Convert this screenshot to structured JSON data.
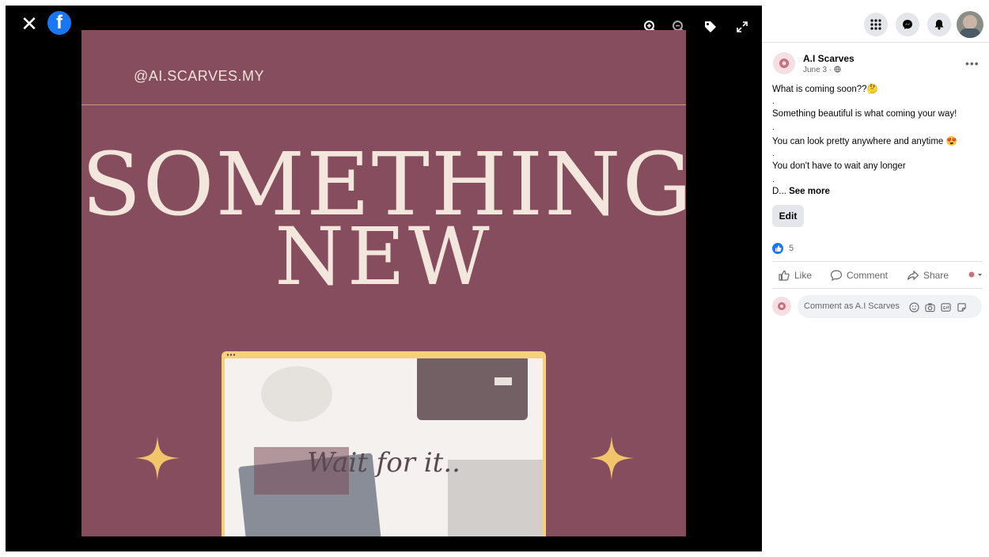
{
  "viewer": {
    "close_glyph": "✕",
    "logo_glyph": "f",
    "controls": [
      "zoom-in-icon",
      "zoom-out-icon",
      "tag-icon",
      "fullscreen-icon"
    ],
    "image": {
      "handle": "@AI.SCARVES.MY",
      "headline_line1": "SOMETHING",
      "headline_line2": "NEW",
      "inset_text": "Wait for it..",
      "background_color": "#864d5e",
      "accent_color": "#f6d17a"
    }
  },
  "sidebar": {
    "nav_icons": [
      "menu-grid-icon",
      "messenger-icon",
      "notifications-icon",
      "profile-avatar"
    ],
    "post": {
      "page_name": "A.I Scarves",
      "date": "June 3 ·",
      "more_glyph": "•••",
      "lines": [
        "What is coming soon??🤔",
        ".",
        "Something beautiful is what coming your way!",
        ".",
        "You can look pretty anywhere and anytime 😍",
        ".",
        "You don't have to wait any longer",
        "."
      ],
      "truncated_prefix": "D...",
      "see_more": "See more",
      "edit_label": "Edit",
      "like_count": "5"
    },
    "actions": {
      "like": "Like",
      "comment": "Comment",
      "share": "Share"
    },
    "comment_box": {
      "placeholder": "Comment as A.I Scarves"
    },
    "colors": {
      "brand": "#1877f2",
      "secondary_text": "#65676b"
    }
  }
}
